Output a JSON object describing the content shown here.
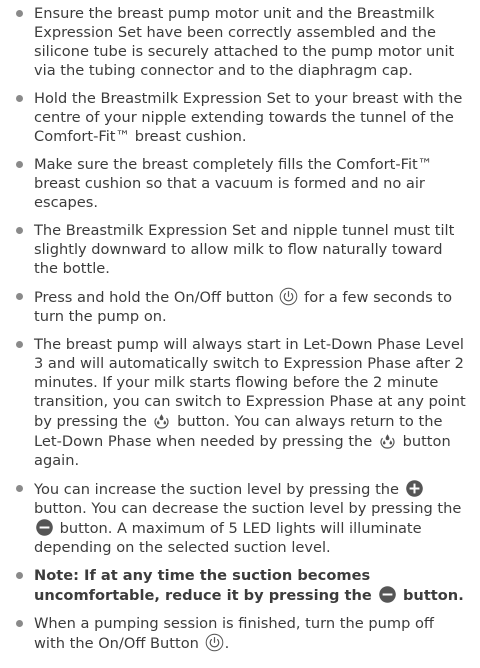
{
  "instructions": [
    {
      "text": "Ensure the breast pump motor unit and the Breastmilk Expression Set have been correctly assembled and the silicone tube is securely attached to the pump motor unit via the tubing connector and to the diaphragm cap."
    },
    {
      "text": "Hold the Breastmilk Expression Set to your breast with the centre of your nipple extending towards the tunnel of the Comfort-Fit™ breast cushion."
    },
    {
      "text": "Make sure the breast completely fills the Comfort-Fit™ breast cushion so that a vacuum is formed and no air escapes."
    },
    {
      "text": "The Breastmilk Expression Set and nipple tunnel must tilt slightly downward to allow milk to flow naturally toward the bottle."
    },
    {
      "text_before": "Press and hold the On/Off button",
      "icon": "power-icon",
      "text_after": "for a few seconds to turn the pump on."
    },
    {
      "text_1": "The breast pump will always start in Let-Down Phase Level 3 and will automatically switch to Expression Phase after 2 minutes. If your milk starts flowing before the 2 minute transition, you can switch to Expression Phase at any point by pressing the",
      "icon_1": "milk-drops-icon",
      "text_2": "button. You can always return to the Let-Down Phase when needed by pressing the",
      "icon_2": "milk-drops-icon",
      "text_3": "button again."
    },
    {
      "text_1": "You can increase the suction level by pressing the",
      "icon_1": "plus-circle-icon",
      "text_2": "button. You can decrease the suction level by pressing the",
      "icon_2": "minus-circle-icon",
      "text_3": "button. A maximum of 5 LED lights will illuminate depending on the selected suction level."
    },
    {
      "text_before": "Note: If at any time the suction becomes uncomfortable, reduce it by pressing the",
      "icon": "minus-circle-icon",
      "text_after": "button."
    },
    {
      "text_before": "When a pumping session is finished, turn the pump off with the On/Off Button",
      "icon": "power-icon",
      "text_after": "."
    }
  ],
  "colors": {
    "text": "#3c3c3c",
    "bullet": "#8a8a8a",
    "icon": "#555555"
  }
}
